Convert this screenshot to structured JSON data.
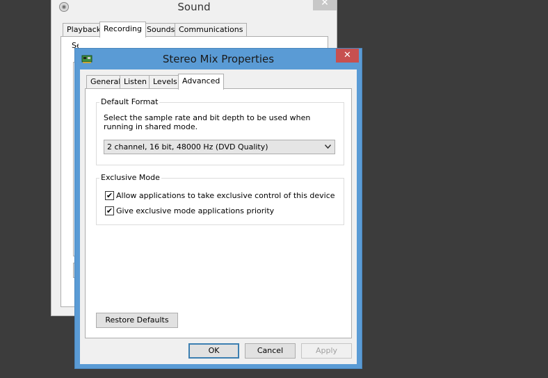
{
  "sound_window": {
    "title": "Sound",
    "close_glyph": "✕",
    "tabs": [
      {
        "label": "Playback"
      },
      {
        "label": "Recording"
      },
      {
        "label": "Sounds"
      },
      {
        "label": "Communications"
      }
    ],
    "description_fragment": "Se"
  },
  "dialog": {
    "title": "Stereo Mix Properties",
    "close_glyph": "✕",
    "tabs": [
      {
        "label": "General"
      },
      {
        "label": "Listen"
      },
      {
        "label": "Levels"
      },
      {
        "label": "Advanced"
      }
    ],
    "default_format": {
      "group_label": "Default Format",
      "description": "Select the sample rate and bit depth to be used when running in shared mode.",
      "selected_value": "2 channel, 16 bit, 48000 Hz (DVD Quality)"
    },
    "exclusive_mode": {
      "group_label": "Exclusive Mode",
      "options": [
        {
          "label": "Allow applications to take exclusive control of this device",
          "checked": true
        },
        {
          "label": "Give exclusive mode applications priority",
          "checked": true
        }
      ]
    },
    "restore_defaults_label": "Restore Defaults",
    "ok_label": "OK",
    "cancel_label": "Cancel",
    "apply_label": "Apply",
    "check_glyph": "✔"
  },
  "colors": {
    "dialog_frame": "#5a9bd5",
    "close_button": "#c75050",
    "desktop": "#3c3c3c"
  }
}
